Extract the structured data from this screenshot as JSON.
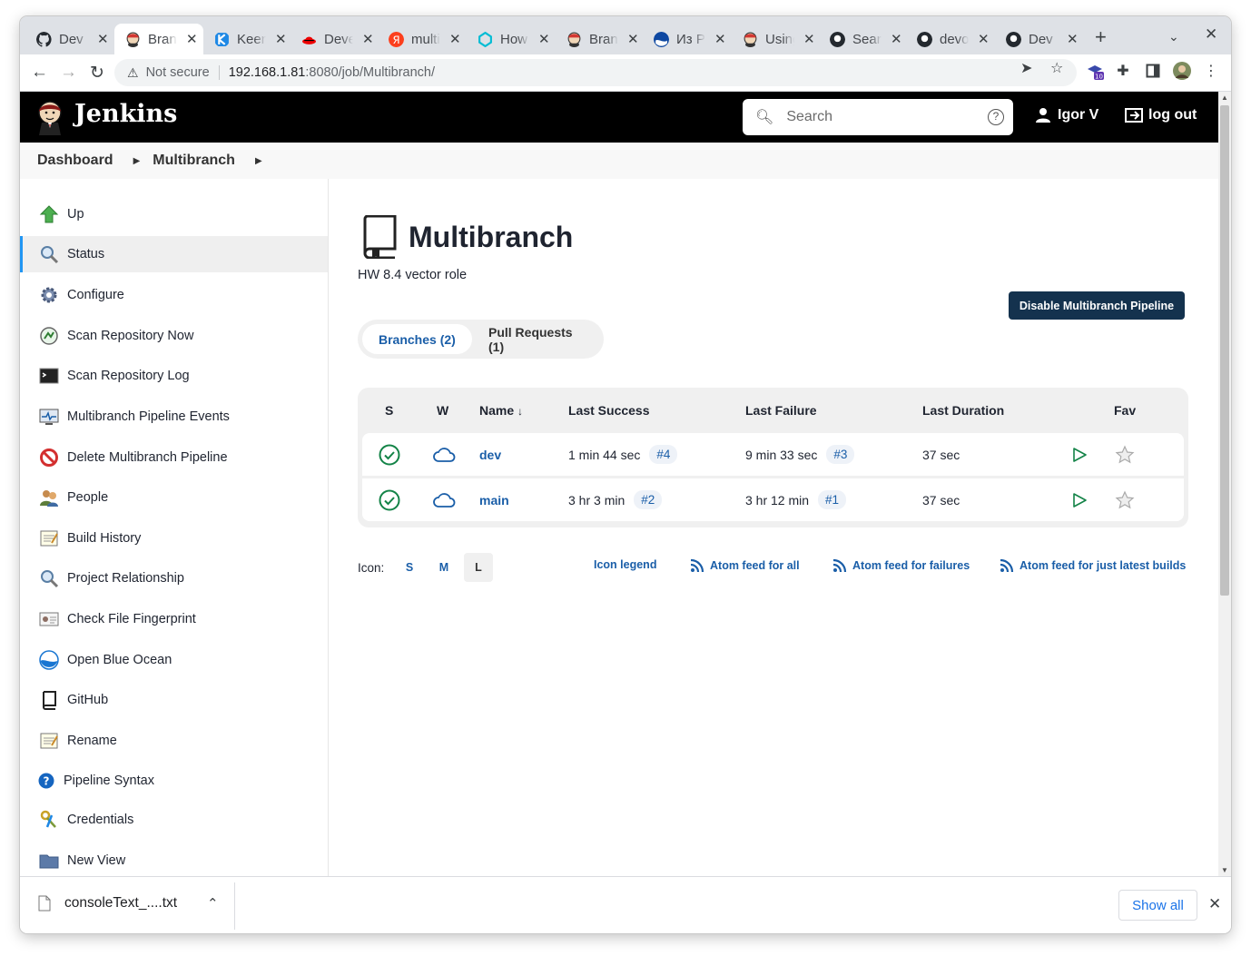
{
  "browser": {
    "tabs": [
      {
        "label": "Dev Env",
        "icon": "github-icon",
        "color": "#24292f"
      },
      {
        "label": "Branch",
        "icon": "jenkins-icon",
        "color": "#d33833"
      },
      {
        "label": "Keenetic",
        "icon": "keenetic-icon",
        "color": "#1e88e5"
      },
      {
        "label": "Develop",
        "icon": "redhat-icon",
        "color": "#ee0000"
      },
      {
        "label": "multibranch",
        "icon": "yandex-icon",
        "color": "#fc3f1d"
      },
      {
        "label": "How to",
        "icon": "devopscube-icon",
        "color": "#00bcd4"
      },
      {
        "label": "Branch",
        "icon": "jenkins-icon",
        "color": "#d33833"
      },
      {
        "label": "Из Р",
        "icon": "blueocean-icon",
        "color": "#0d47a1"
      },
      {
        "label": "Using",
        "icon": "jenkins-icon",
        "color": "#d33833"
      },
      {
        "label": "Search",
        "icon": "github-icon",
        "color": "#24292f"
      },
      {
        "label": "devops",
        "icon": "github-icon",
        "color": "#24292f"
      },
      {
        "label": "Dev Env",
        "icon": "github-icon",
        "color": "#24292f"
      }
    ],
    "new_tab": "+",
    "close": "✕",
    "not_secure": "Not secure",
    "url_host": "192.168.1.81",
    "url_path": ":8080/job/Multibranch/",
    "extension_badge": "10"
  },
  "header": {
    "title": "Jenkins",
    "search_placeholder": "Search",
    "help": "?",
    "user": "Igor V",
    "logout": "log out"
  },
  "breadcrumb": [
    "Dashboard",
    "Multibranch"
  ],
  "sidebar": {
    "items": [
      {
        "label": "Up",
        "icon": "up-arrow-icon"
      },
      {
        "label": "Status",
        "icon": "magnifier-icon"
      },
      {
        "label": "Configure",
        "icon": "gear-icon"
      },
      {
        "label": "Scan Repository Now",
        "icon": "scan-icon"
      },
      {
        "label": "Scan Repository Log",
        "icon": "terminal-icon"
      },
      {
        "label": "Multibranch Pipeline Events",
        "icon": "monitor-icon"
      },
      {
        "label": "Delete Multibranch Pipeline",
        "icon": "no-entry-icon"
      },
      {
        "label": "People",
        "icon": "people-icon"
      },
      {
        "label": "Build History",
        "icon": "notepad-icon"
      },
      {
        "label": "Project Relationship",
        "icon": "magnifier-icon"
      },
      {
        "label": "Check File Fingerprint",
        "icon": "fingerprint-icon"
      },
      {
        "label": "Open Blue Ocean",
        "icon": "blueocean-icon"
      },
      {
        "label": "GitHub",
        "icon": "repo-icon"
      },
      {
        "label": "Rename",
        "icon": "notepad-icon"
      },
      {
        "label": "Pipeline Syntax",
        "icon": "help-icon"
      },
      {
        "label": "Credentials",
        "icon": "keys-icon"
      },
      {
        "label": "New View",
        "icon": "folder-icon"
      }
    ]
  },
  "main": {
    "title": "Multibranch",
    "description": "HW 8.4 vector role",
    "disable_button": "Disable Multibranch Pipeline",
    "tabs": [
      {
        "label": "Branches (2)",
        "active": true
      },
      {
        "label": "Pull Requests (1)",
        "active": false
      }
    ],
    "table": {
      "headers": {
        "s": "S",
        "w": "W",
        "name": "Name",
        "sort": "↓",
        "last_success": "Last Success",
        "last_failure": "Last Failure",
        "last_duration": "Last Duration",
        "fav": "Fav"
      },
      "rows": [
        {
          "name": "dev",
          "last_success": "1 min 44 sec",
          "success_build": "#4",
          "last_failure": "9 min 33 sec",
          "failure_build": "#3",
          "duration": "37 sec"
        },
        {
          "name": "main",
          "last_success": "3 hr 3 min",
          "success_build": "#2",
          "last_failure": "3 hr 12 min",
          "failure_build": "#1",
          "duration": "37 sec"
        }
      ]
    },
    "icon_label": "Icon:",
    "icon_sizes": [
      "S",
      "M",
      "L"
    ],
    "icon_legend": "Icon legend",
    "feeds": [
      "Atom feed for all",
      "Atom feed for failures",
      "Atom feed for just latest builds"
    ]
  },
  "downloads": {
    "file": "consoleText_....txt",
    "show_all": "Show all"
  },
  "colors": {
    "success": "#138347",
    "link": "#1a5ea8",
    "button_dark": "#14324e",
    "header_bg": "#000000"
  }
}
